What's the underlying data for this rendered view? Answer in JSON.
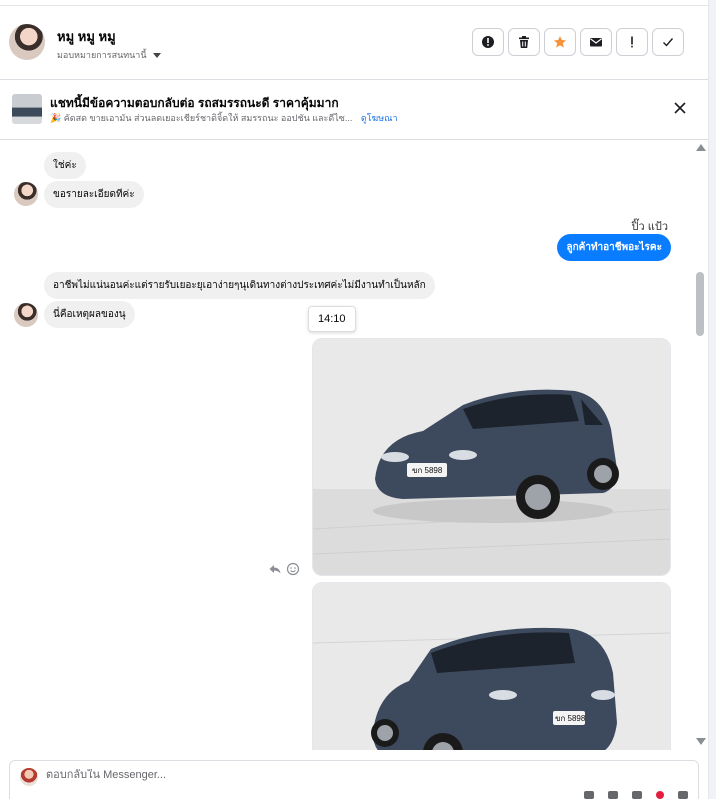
{
  "header": {
    "user_name": "หมู หมู หมู",
    "assign_label": "มอบหมายการสนทนานี้",
    "actions": [
      {
        "name": "report-spam-button",
        "icon": "alert-circle-icon"
      },
      {
        "name": "delete-button",
        "icon": "trash-icon"
      },
      {
        "name": "star-button",
        "icon": "star-icon"
      },
      {
        "name": "mark-unread-button",
        "icon": "envelope-icon"
      },
      {
        "name": "follow-up-button",
        "icon": "exclamation-icon"
      },
      {
        "name": "mark-done-button",
        "icon": "check-icon"
      }
    ],
    "colors": {
      "star": "#f7923b"
    }
  },
  "ad": {
    "title": "แชทนี้มีข้อความตอบกลับต่อ รถสมรรถนะดี ราคาคุ้มมาก",
    "subtitle": "🎉 คัดสด ขายเอามัน ส่วนลดเยอะเชียร์ชาดิจิ้ดให้ สมรรถนะ ออปชัน และดีไซ...",
    "link": "ดูโฆษณา"
  },
  "messages": {
    "received_1": "ใช่ค่ะ",
    "received_2": "ขอรายละเอียดทีค่ะ",
    "sender_name": "ปิ๊ว แป้ว",
    "sent_1": "ลูกค้าทำอาชีพอะไรคะ",
    "received_3": "อาชีพไม่แน่นอนค่ะแต่รายรับเยอะยุเอาง่ายๆนุเดินทางต่างประเทศค่ะไม่มีงานทำเป็นหลัก",
    "received_4": "นี่คือเหตุผลของนุ",
    "timestamp": "14:10",
    "images": [
      {
        "plate": "ขก 5898",
        "subject": "car-photo"
      },
      {
        "plate": "ขก 5898",
        "subject": "car-photo"
      }
    ],
    "colors": {
      "sent_bubble": "#0a7cff",
      "received_bubble": "#f0f0f0"
    }
  },
  "composer": {
    "placeholder": "ตอบกลับใน Messenger..."
  }
}
